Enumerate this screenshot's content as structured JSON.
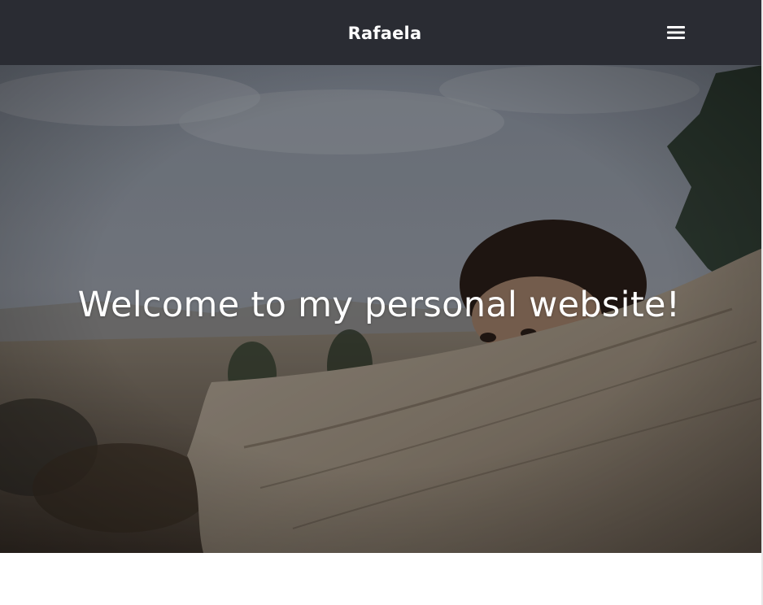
{
  "navbar": {
    "brand": "Rafaela",
    "menu_icon": "hamburger-menu-icon",
    "background": "#2a2c33"
  },
  "hero": {
    "title": "Welcome to my personal website!",
    "image": "woman-peeking-over-fallen-log-photo",
    "overlay": "#000000"
  }
}
